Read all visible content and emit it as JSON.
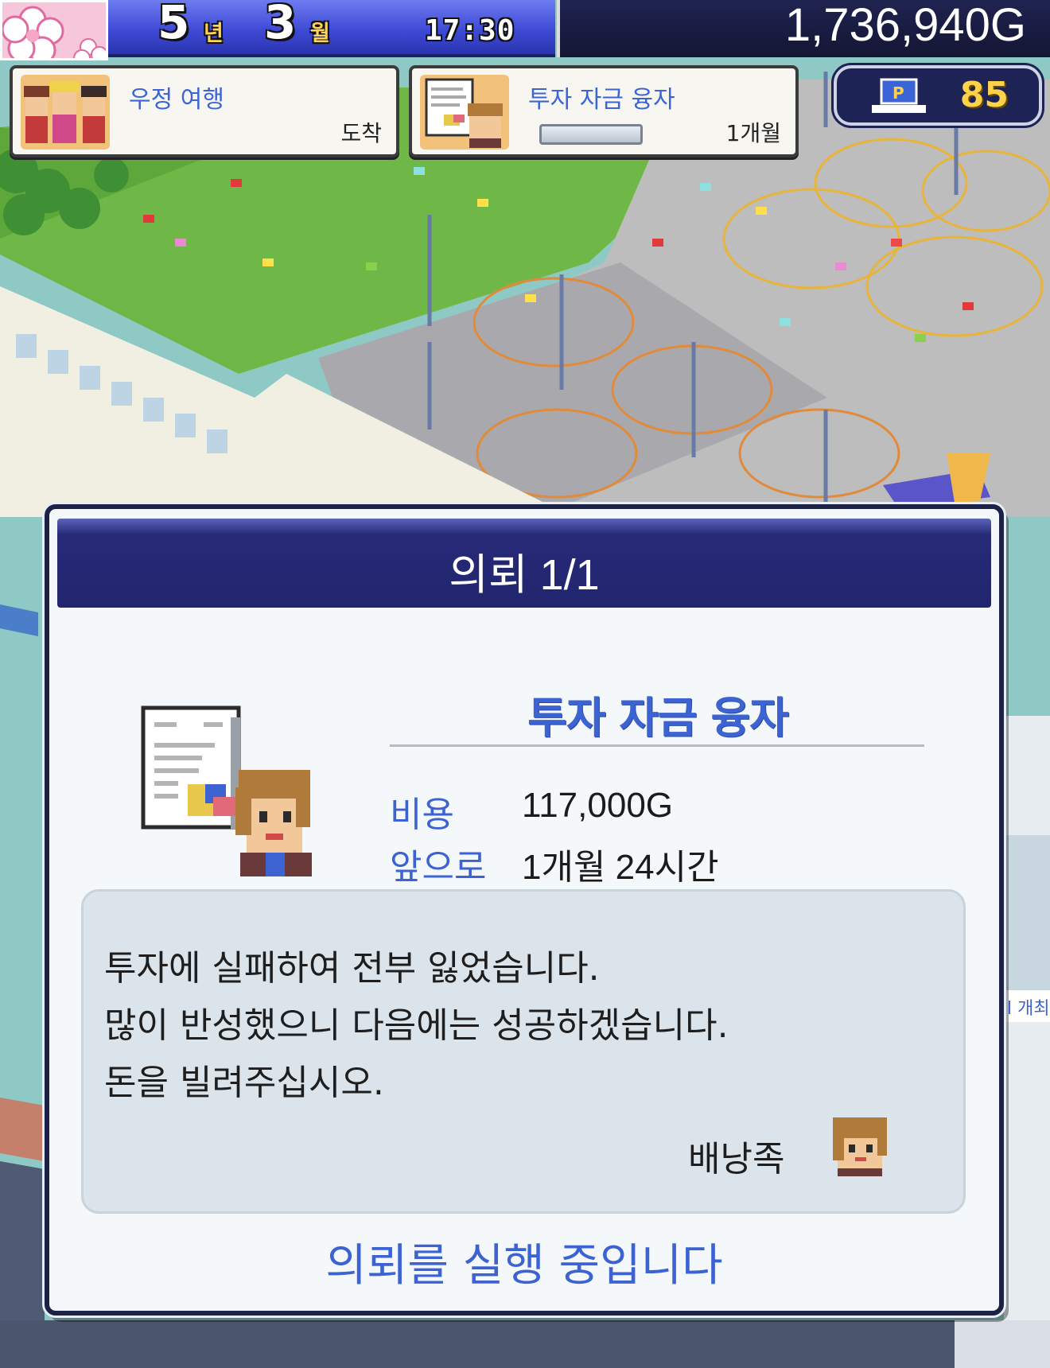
{
  "hud": {
    "year_value": "5",
    "year_unit": "년",
    "month_value": "3",
    "month_unit": "월",
    "time": "17:30",
    "money": "1,736,940G",
    "points": "85"
  },
  "notifications": [
    {
      "title": "우정 여행",
      "status": "도착"
    },
    {
      "title": "투자 자금 융자",
      "status": "1개월",
      "progress": 0.0
    }
  ],
  "dialog": {
    "title": "의뢰 1/1",
    "request_name": "투자 자금 융자",
    "cost_label": "비용",
    "cost_value": "117,000G",
    "remaining_label": "앞으로",
    "remaining_value": "1개월 24시간",
    "message_lines": [
      "투자에 실패하여 전부 잃었습니다.",
      "많이 반성했으니 다음에는 성공하겠습니다.",
      "돈을 빌려주십시오."
    ],
    "sender": "배낭족",
    "status": "의뢰를 실행 중입니다"
  },
  "background_text": {
    "sign_fragment": "l 개최"
  },
  "colors": {
    "accent_blue": "#3d63d2",
    "dialog_header": "#262a78",
    "money_panel": "#1f2350",
    "points_gold": "#ffd24a"
  },
  "icons": {
    "season": "cherry-blossom-icon",
    "points": "laptop-points-icon",
    "request": "document-chart-icon"
  }
}
